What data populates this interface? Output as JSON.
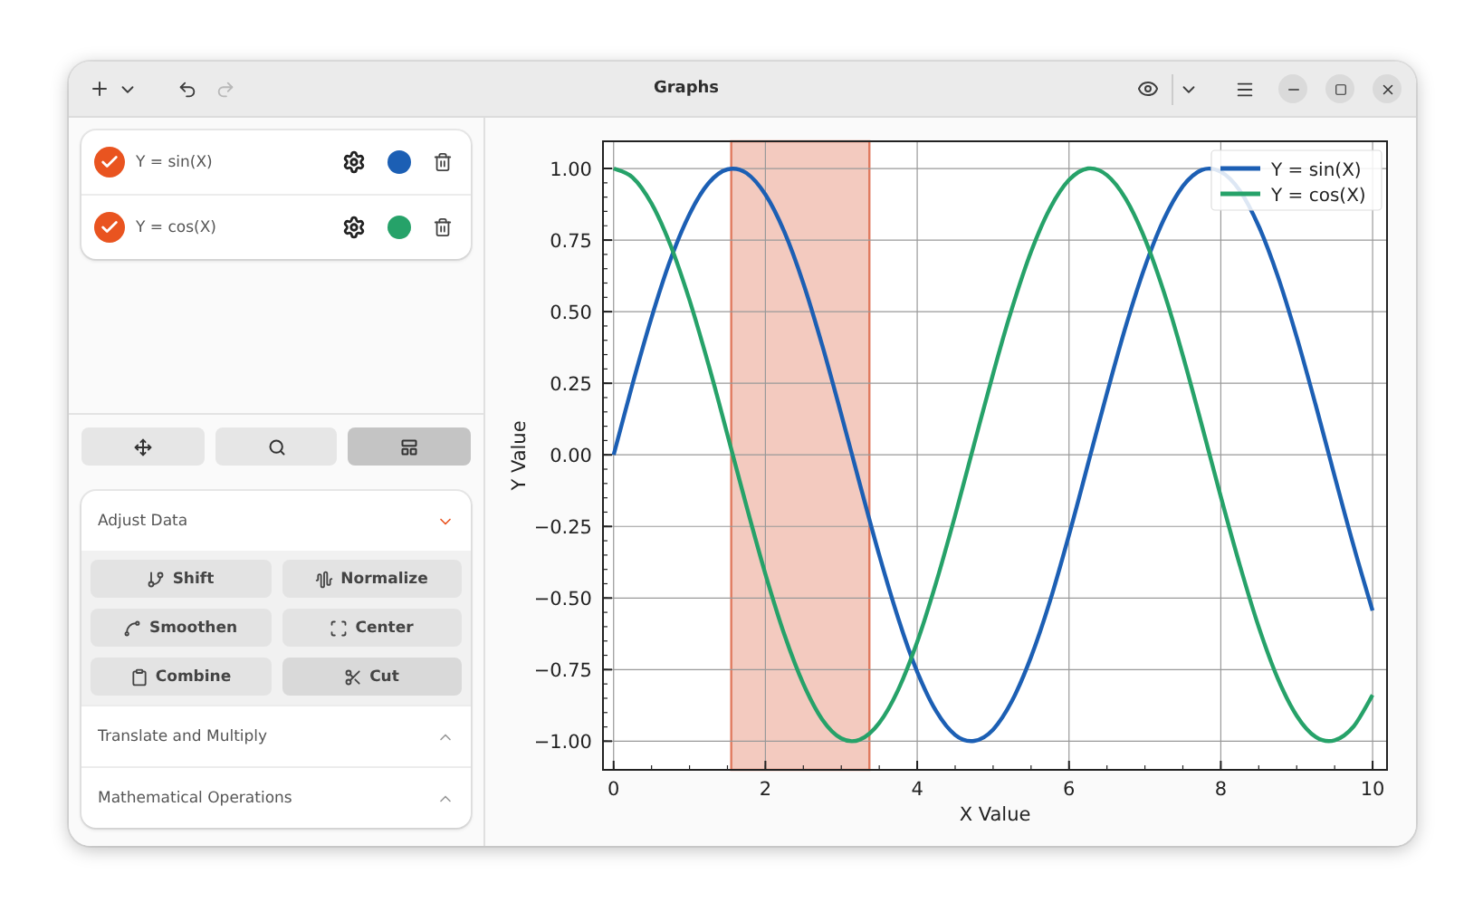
{
  "window": {
    "title": "Graphs",
    "redo": {
      "disabled": true
    }
  },
  "items": [
    {
      "label": "Y = sin(X)",
      "checked": true,
      "color": "#1c5fb4"
    },
    {
      "label": "Y = cos(X)",
      "checked": true,
      "color": "#26a269"
    }
  ],
  "tools": [
    {
      "kind": "pan",
      "selected": false
    },
    {
      "kind": "zoom",
      "selected": false
    },
    {
      "kind": "select",
      "selected": true
    }
  ],
  "sections": [
    {
      "title": "Adjust Data",
      "expanded": true,
      "actions": [
        {
          "kind": "shift",
          "label": "Shift",
          "highlighted": false
        },
        {
          "kind": "normalize",
          "label": "Normalize",
          "highlighted": false
        },
        {
          "kind": "smoothen",
          "label": "Smoothen",
          "highlighted": false
        },
        {
          "kind": "center",
          "label": "Center",
          "highlighted": false
        },
        {
          "kind": "combine",
          "label": "Combine",
          "highlighted": false
        },
        {
          "kind": "cut",
          "label": "Cut",
          "highlighted": true
        }
      ]
    },
    {
      "title": "Translate and Multiply",
      "expanded": false
    },
    {
      "title": "Mathematical Operations",
      "expanded": false
    }
  ],
  "plot": {
    "chart_data": {
      "type": "line",
      "xlabel": "X Value",
      "ylabel": "Y Value",
      "x": [
        0,
        0.25,
        0.5,
        0.75,
        1,
        1.25,
        1.5,
        1.75,
        2,
        2.25,
        2.5,
        2.75,
        3,
        3.25,
        3.5,
        3.75,
        4,
        4.25,
        4.5,
        4.75,
        5,
        5.25,
        5.5,
        5.75,
        6,
        6.25,
        6.5,
        6.75,
        7,
        7.25,
        7.5,
        7.75,
        8,
        8.25,
        8.5,
        8.75,
        9,
        9.25,
        9.5,
        9.75,
        10
      ],
      "series": [
        {
          "name": "Y = sin(X)",
          "color": "#1c5fb4",
          "values": [
            0,
            0.247,
            0.479,
            0.682,
            0.841,
            0.949,
            0.997,
            0.984,
            0.909,
            0.778,
            0.598,
            0.382,
            0.141,
            -0.108,
            -0.351,
            -0.572,
            -0.757,
            -0.895,
            -0.978,
            -0.999,
            -0.959,
            -0.859,
            -0.706,
            -0.51,
            -0.279,
            -0.033,
            0.215,
            0.451,
            0.657,
            0.823,
            0.938,
            0.995,
            0.989,
            0.923,
            0.798,
            0.625,
            0.412,
            0.174,
            -0.075,
            -0.319,
            -0.544
          ]
        },
        {
          "name": "Y = cos(X)",
          "color": "#26a269",
          "values": [
            1,
            0.969,
            0.878,
            0.732,
            0.54,
            0.315,
            0.071,
            -0.178,
            -0.416,
            -0.628,
            -0.801,
            -0.924,
            -0.99,
            -0.994,
            -0.936,
            -0.82,
            -0.654,
            -0.446,
            -0.211,
            0.038,
            0.284,
            0.512,
            0.709,
            0.861,
            0.96,
            1,
            0.977,
            0.893,
            0.754,
            0.568,
            0.347,
            0.104,
            -0.146,
            -0.385,
            -0.602,
            -0.78,
            -0.911,
            -0.985,
            -0.997,
            -0.948,
            -0.839
          ]
        }
      ],
      "xlim": [
        -0.14,
        10.19
      ],
      "ylim": [
        -1.1,
        1.095
      ],
      "xticks": [
        0,
        2,
        4,
        6,
        8,
        10
      ],
      "yticks": [
        {
          "value": -1,
          "label": "−1.00"
        },
        {
          "value": -0.75,
          "label": "−0.75"
        },
        {
          "value": -0.5,
          "label": "−0.50"
        },
        {
          "value": -0.25,
          "label": "−0.25"
        },
        {
          "value": 0,
          "label": "0.00"
        },
        {
          "value": 0.25,
          "label": "0.25"
        },
        {
          "value": 0.5,
          "label": "0.50"
        },
        {
          "value": 0.75,
          "label": "0.75"
        },
        {
          "value": 1,
          "label": "1.00"
        }
      ],
      "grid": true,
      "legend": "upper right",
      "bands": [
        {
          "axis": "x",
          "from": 1.55,
          "to": 3.37,
          "color": "#e07a5f"
        }
      ]
    }
  }
}
